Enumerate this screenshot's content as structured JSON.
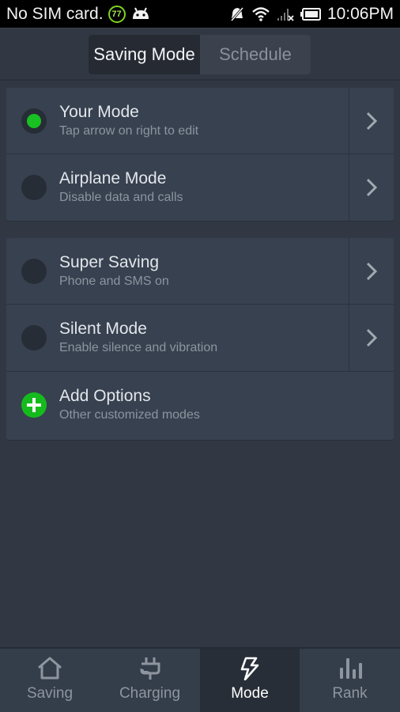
{
  "status_bar": {
    "carrier": "No SIM card.",
    "badge": "77",
    "time": "10:06PM",
    "icons": [
      "battery-saver-badge-icon",
      "android-icon",
      "notifications-muted-icon",
      "wifi-icon",
      "no-signal-icon",
      "battery-icon"
    ]
  },
  "header": {
    "tabs": [
      {
        "label": "Saving Mode",
        "active": true
      },
      {
        "label": "Schedule",
        "active": false
      }
    ]
  },
  "modes": {
    "group1": [
      {
        "title": "Your Mode",
        "subtitle": "Tap arrow on right to edit",
        "selected": true
      },
      {
        "title": "Airplane Mode",
        "subtitle": "Disable data and calls",
        "selected": false
      }
    ],
    "group2": [
      {
        "title": "Super Saving",
        "subtitle": "Phone and SMS on",
        "selected": false
      },
      {
        "title": "Silent Mode",
        "subtitle": "Enable silence and vibration",
        "selected": false
      }
    ],
    "add_option": {
      "title": "Add Options",
      "subtitle": "Other customized modes"
    }
  },
  "bottom_nav": {
    "items": [
      {
        "label": "Saving",
        "icon": "home-icon",
        "active": false
      },
      {
        "label": "Charging",
        "icon": "plug-icon",
        "active": false
      },
      {
        "label": "Mode",
        "icon": "lightning-icon",
        "active": true
      },
      {
        "label": "Rank",
        "icon": "bar-chart-icon",
        "active": false
      }
    ]
  },
  "colors": {
    "accent_green": "#18c021",
    "background": "#313843",
    "card": "#374150"
  }
}
